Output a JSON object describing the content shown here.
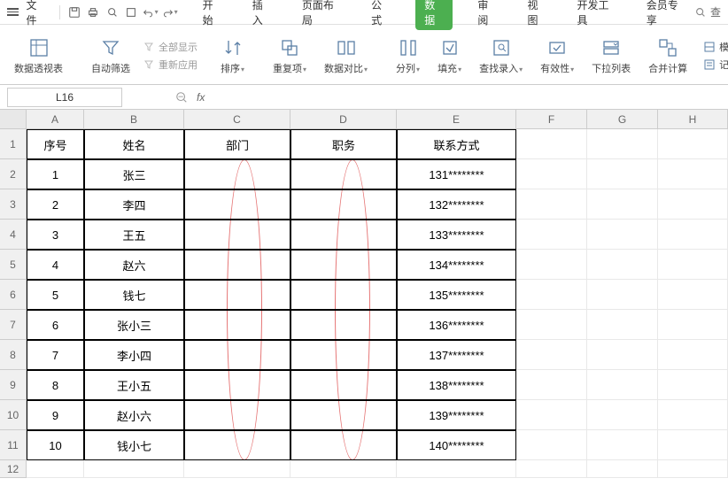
{
  "menubar": {
    "file_label": "文件",
    "tabs": [
      "开始",
      "插入",
      "页面布局",
      "公式",
      "数据",
      "审阅",
      "视图",
      "开发工具",
      "会员专享"
    ],
    "active_tab_index": 4,
    "search_label": "查"
  },
  "ribbon": {
    "pivot": "数据透视表",
    "autofilter": "自动筛选",
    "show_all": "全部显示",
    "reapply": "重新应用",
    "sort": "排序",
    "duplicates": "重复项",
    "data_compare": "数据对比",
    "text_to_cols": "分列",
    "fill": "填充",
    "find_entry": "查找录入",
    "validation": "有效性",
    "dropdown_list": "下拉列表",
    "consolidate": "合并计算",
    "whatif": "模拟分析",
    "record_form": "记录单"
  },
  "namebox": {
    "value": "L16"
  },
  "columns": [
    "A",
    "B",
    "C",
    "D",
    "E",
    "F",
    "G",
    "H"
  ],
  "headers": {
    "A": "序号",
    "B": "姓名",
    "C": "部门",
    "D": "职务",
    "E": "联系方式"
  },
  "rows": [
    {
      "n": "1",
      "A": "1",
      "B": "张三",
      "C": "",
      "D": "",
      "E": "131********"
    },
    {
      "n": "2",
      "A": "2",
      "B": "李四",
      "C": "",
      "D": "",
      "E": "132********"
    },
    {
      "n": "3",
      "A": "3",
      "B": "王五",
      "C": "",
      "D": "",
      "E": "133********"
    },
    {
      "n": "4",
      "A": "4",
      "B": "赵六",
      "C": "",
      "D": "",
      "E": "134********"
    },
    {
      "n": "5",
      "A": "5",
      "B": "钱七",
      "C": "",
      "D": "",
      "E": "135********"
    },
    {
      "n": "6",
      "A": "6",
      "B": "张小三",
      "C": "",
      "D": "",
      "E": "136********"
    },
    {
      "n": "7",
      "A": "7",
      "B": "李小四",
      "C": "",
      "D": "",
      "E": "137********"
    },
    {
      "n": "8",
      "A": "8",
      "B": "王小五",
      "C": "",
      "D": "",
      "E": "138********"
    },
    {
      "n": "9",
      "A": "9",
      "B": "赵小六",
      "C": "",
      "D": "",
      "E": "139********"
    },
    {
      "n": "10",
      "A": "10",
      "B": "钱小七",
      "C": "",
      "D": "",
      "E": "140********"
    }
  ]
}
